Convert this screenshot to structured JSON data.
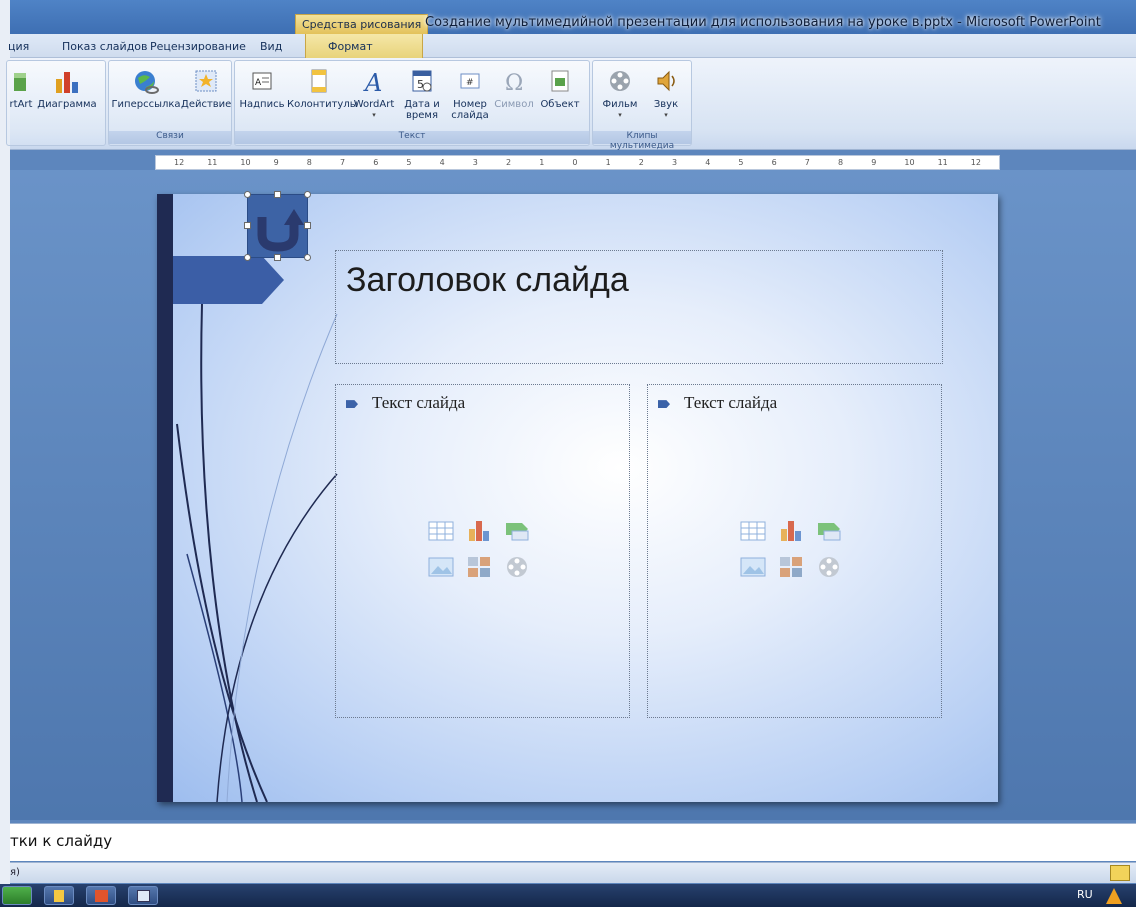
{
  "window": {
    "title": "Создание мультимедийной презентации для использования на уроке в.pptx - Microsoft PowerPoint",
    "contextual_tab_group": "Средства рисования"
  },
  "tabs": {
    "items": [
      {
        "label": "ция"
      },
      {
        "label": "Показ слайдов"
      },
      {
        "label": "Рецензирование"
      },
      {
        "label": "Вид"
      }
    ],
    "format_label": "Формат"
  },
  "ribbon": {
    "groups": {
      "illustrations": {
        "items": [
          {
            "label": "rtArt",
            "icon": "smartart-icon"
          },
          {
            "label": "Диаграмма",
            "icon": "chart-icon"
          }
        ]
      },
      "links": {
        "label": "Связи",
        "items": [
          {
            "label": "Гиперссылка",
            "icon": "globe-link-icon"
          },
          {
            "label": "Действие",
            "icon": "action-star-icon"
          }
        ]
      },
      "text": {
        "label": "Текст",
        "items": [
          {
            "label": "Надпись",
            "icon": "textbox-icon"
          },
          {
            "label": "Колонтитулы",
            "icon": "header-footer-icon"
          },
          {
            "label": "WordArt",
            "icon": "wordart-icon"
          },
          {
            "label": "Дата и время",
            "icon": "calendar-icon"
          },
          {
            "label": "Номер слайда",
            "icon": "slide-number-icon"
          },
          {
            "label": "Символ",
            "icon": "omega-icon",
            "disabled": true
          },
          {
            "label": "Объект",
            "icon": "object-icon"
          }
        ]
      },
      "media": {
        "label": "Клипы мультимедиа",
        "items": [
          {
            "label": "Фильм",
            "icon": "film-reel-icon"
          },
          {
            "label": "Звук",
            "icon": "speaker-icon"
          }
        ]
      }
    }
  },
  "ruler": {
    "marks": [
      "12",
      "11",
      "10",
      "9",
      "8",
      "7",
      "6",
      "5",
      "4",
      "3",
      "2",
      "1",
      "0",
      "1",
      "2",
      "3",
      "4",
      "5",
      "6",
      "7",
      "8",
      "9",
      "10",
      "11",
      "12"
    ]
  },
  "slide": {
    "title_placeholder": "Заголовок слайда",
    "left_placeholder": "Текст слайда",
    "right_placeholder": "Текст слайда",
    "accent_color": "#1f2a52",
    "selected_shape_color": "#3d63a5"
  },
  "notes": {
    "text": "тки к слайду"
  },
  "status": {
    "text": "я)"
  },
  "taskbar": {
    "language": "RU"
  }
}
